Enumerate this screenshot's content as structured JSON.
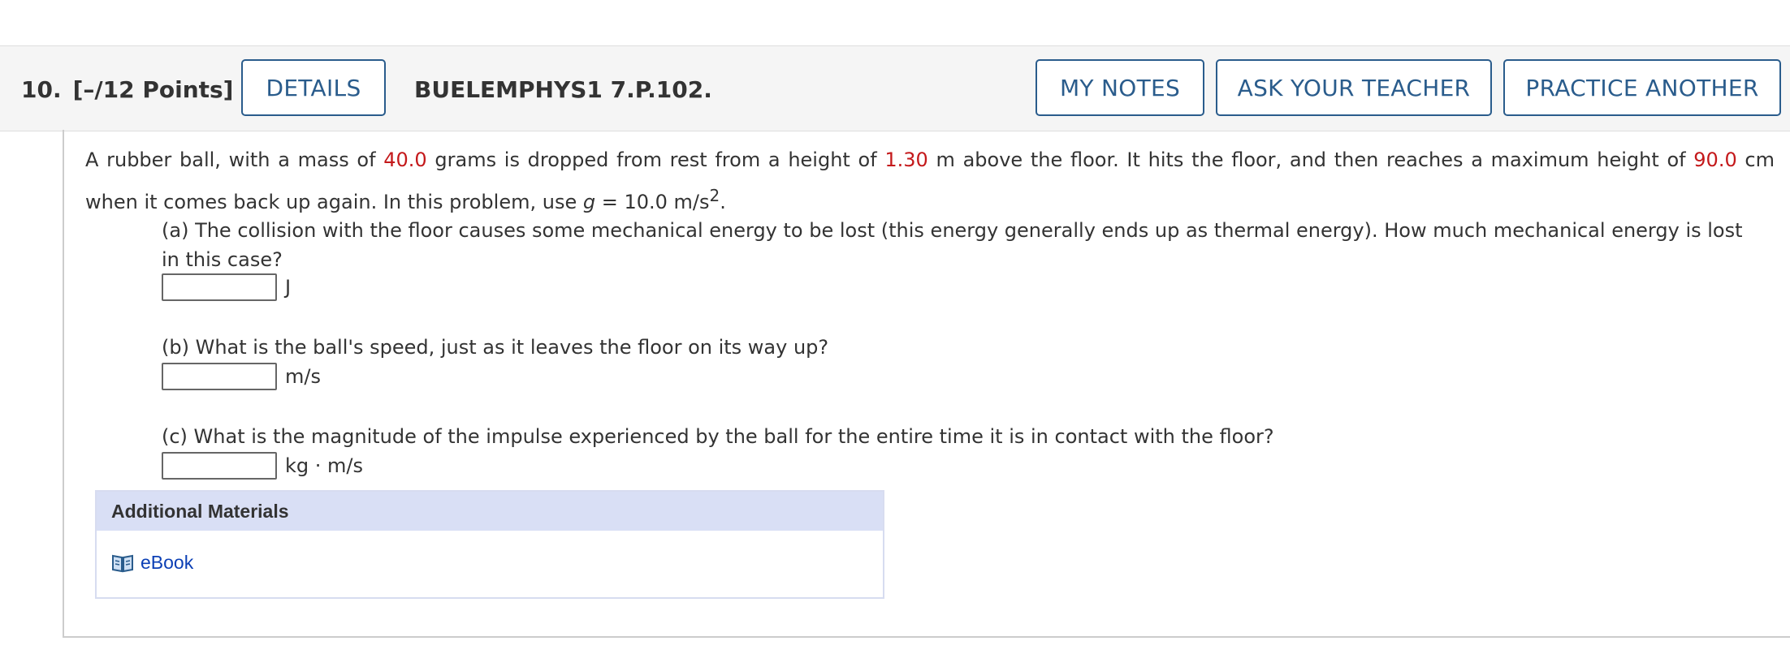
{
  "header": {
    "question_number": "10.",
    "points": "[–/12 Points]",
    "details_label": "DETAILS",
    "question_code": "BUELEMPHYS1 7.P.102.",
    "my_notes_label": "MY NOTES",
    "ask_teacher_label": "ASK YOUR TEACHER",
    "practice_another_label": "PRACTICE ANOTHER"
  },
  "problem": {
    "intro_1": "A rubber ball, with a mass of ",
    "mass": "40.0",
    "intro_2": " grams is dropped from rest from a height of ",
    "height": "1.30",
    "intro_3": " m above the floor. It hits the floor, and then reaches a maximum height of ",
    "max_height": "90.0",
    "intro_4": " cm when it comes back up again. In this problem, use ",
    "g_symbol": "g",
    "g_value": " = 10.0 m/s",
    "g_exp": "2",
    "g_end": "."
  },
  "parts": [
    {
      "question": "(a) The collision with the floor causes some mechanical energy to be lost (this energy generally ends up as thermal energy). How much mechanical energy is lost in this case?",
      "value": "",
      "unit": "J"
    },
    {
      "question": "(b) What is the ball's speed, just as it leaves the floor on its way up?",
      "value": "",
      "unit": "m/s"
    },
    {
      "question": "(c) What is the magnitude of the impulse experienced by the ball for the entire time it is in contact with the floor?",
      "value": "",
      "unit": "kg · m/s"
    }
  ],
  "materials": {
    "heading": "Additional Materials",
    "ebook_label": "eBook",
    "ebook_icon": "book-icon"
  },
  "colors": {
    "accent": "#2a5c8c",
    "highlight": "#c4191b",
    "link": "#0b3fb5"
  }
}
